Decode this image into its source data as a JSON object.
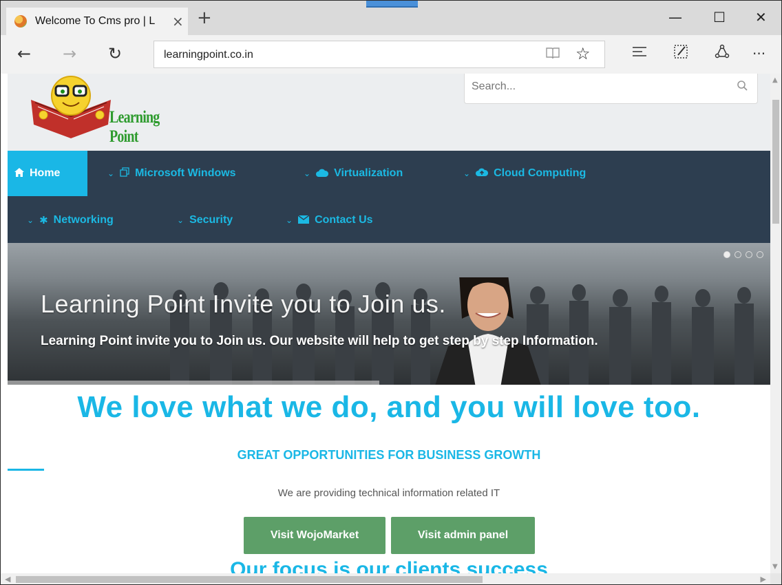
{
  "browser": {
    "tab_title": "Welcome To Cms pro | L",
    "url": "learningpoint.co.in",
    "icons": {
      "tab_close": "×",
      "new_tab": "+",
      "minimize": "—",
      "maximize": "☐",
      "close": "✕",
      "back": "←",
      "forward": "→",
      "refresh": "↻",
      "reading_view": "📖",
      "favorite": "☆",
      "hub": "☰",
      "notes": "✎",
      "share": "⟲",
      "more": "···"
    }
  },
  "site": {
    "brand": "Learning Point",
    "search_placeholder": "Search...",
    "menu": {
      "home": "Home",
      "microsoft_windows": "Microsoft Windows",
      "virtualization": "Virtualization",
      "cloud_computing": "Cloud Computing",
      "networking": "Networking",
      "security": "Security",
      "contact_us": "Contact Us"
    },
    "hero": {
      "title": "Learning Point Invite you to Join us.",
      "subtitle": "Learning Point invite you to Join us. Our website will help to get step by step Information."
    },
    "headline": "We love what we do, and you will love too.",
    "subheadline": "GREAT OPPORTUNITIES FOR BUSINESS GROWTH",
    "description": "We are providing technical information related IT",
    "buttons": {
      "wojomarket": "Visit WojoMarket",
      "admin": "Visit admin panel"
    },
    "focus": "Our focus is our clients success"
  },
  "colors": {
    "accent": "#1ab7e6",
    "menu_bg": "#2d3e50",
    "button": "#5d9f68",
    "brand_text": "#2e9b2e"
  }
}
